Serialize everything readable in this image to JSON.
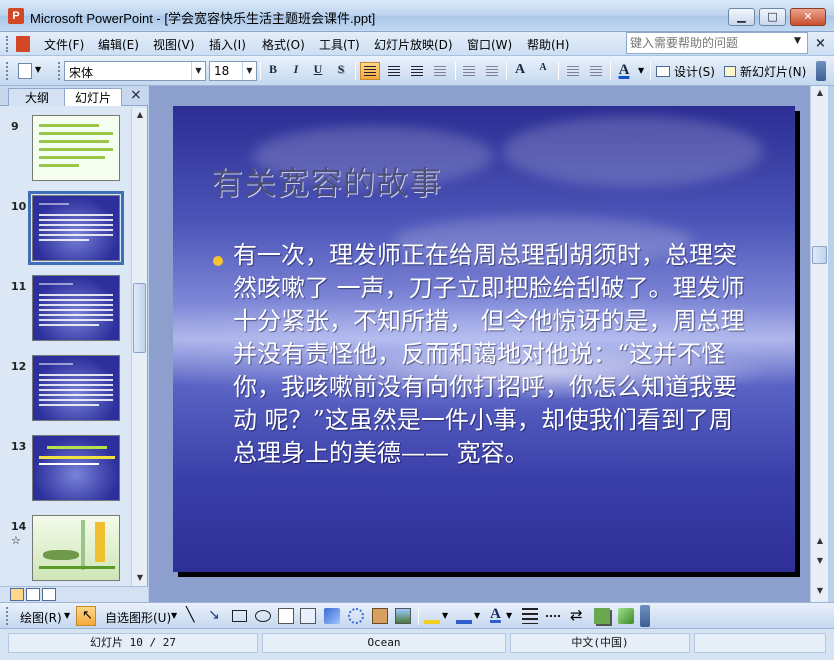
{
  "window": {
    "title": "Microsoft PowerPoint - [学会宽容快乐生活主题班会课件.ppt]",
    "app_icon_letter": "P",
    "minimize": "▁",
    "maximize": "□",
    "close": "✕"
  },
  "menu": {
    "items": [
      "文件(F)",
      "编辑(E)",
      "视图(V)",
      "插入(I)",
      "格式(O)",
      "工具(T)",
      "幻灯片放映(D)",
      "窗口(W)",
      "帮助(H)"
    ],
    "help_placeholder": "键入需要帮助的问题",
    "close_glyph": "×"
  },
  "toolbar": {
    "font_name": "宋体",
    "font_size": "18",
    "bold": "B",
    "italic": "I",
    "underline": "U",
    "shadow": "S",
    "design_label": "设计(S)",
    "new_slide_label": "新幻灯片(N)",
    "font_color_glyph": "A",
    "grow_glyph": "A",
    "shrink_glyph": "A"
  },
  "left_pane": {
    "tab_outline": "大纲",
    "tab_slides": "幻灯片",
    "close_glyph": "×",
    "slide_numbers": [
      "9",
      "10",
      "11",
      "12",
      "13",
      "14"
    ],
    "selected_slide": "10",
    "slide14_star": "☆"
  },
  "slide": {
    "title": "有关宽容的故事",
    "body": "有一次，理发师正在给周总理刮胡须时，总理突然咳嗽了 一声，刀子立即把脸给刮破了。理发师十分紧张，不知所措， 但令他惊讶的是，周总理并没有责怪他，反而和蔼地对他说：“这并不怪你，我咳嗽前没有向你打招呼，你怎么知道我要动 呢？”这虽然是一件小事，却使我们看到了周总理身上的美德—— 宽容。"
  },
  "drawbar": {
    "draw_label": "绘图(R)",
    "autoshapes_label": "自选图形(U)"
  },
  "status": {
    "slide_info": "幻灯片 10 / 27",
    "theme": "Ocean",
    "language": "中文(中国)"
  },
  "colors": {
    "accent": "#3e6eb8",
    "bullet": "#f4c430",
    "slide_title": "#4b4f7a"
  }
}
